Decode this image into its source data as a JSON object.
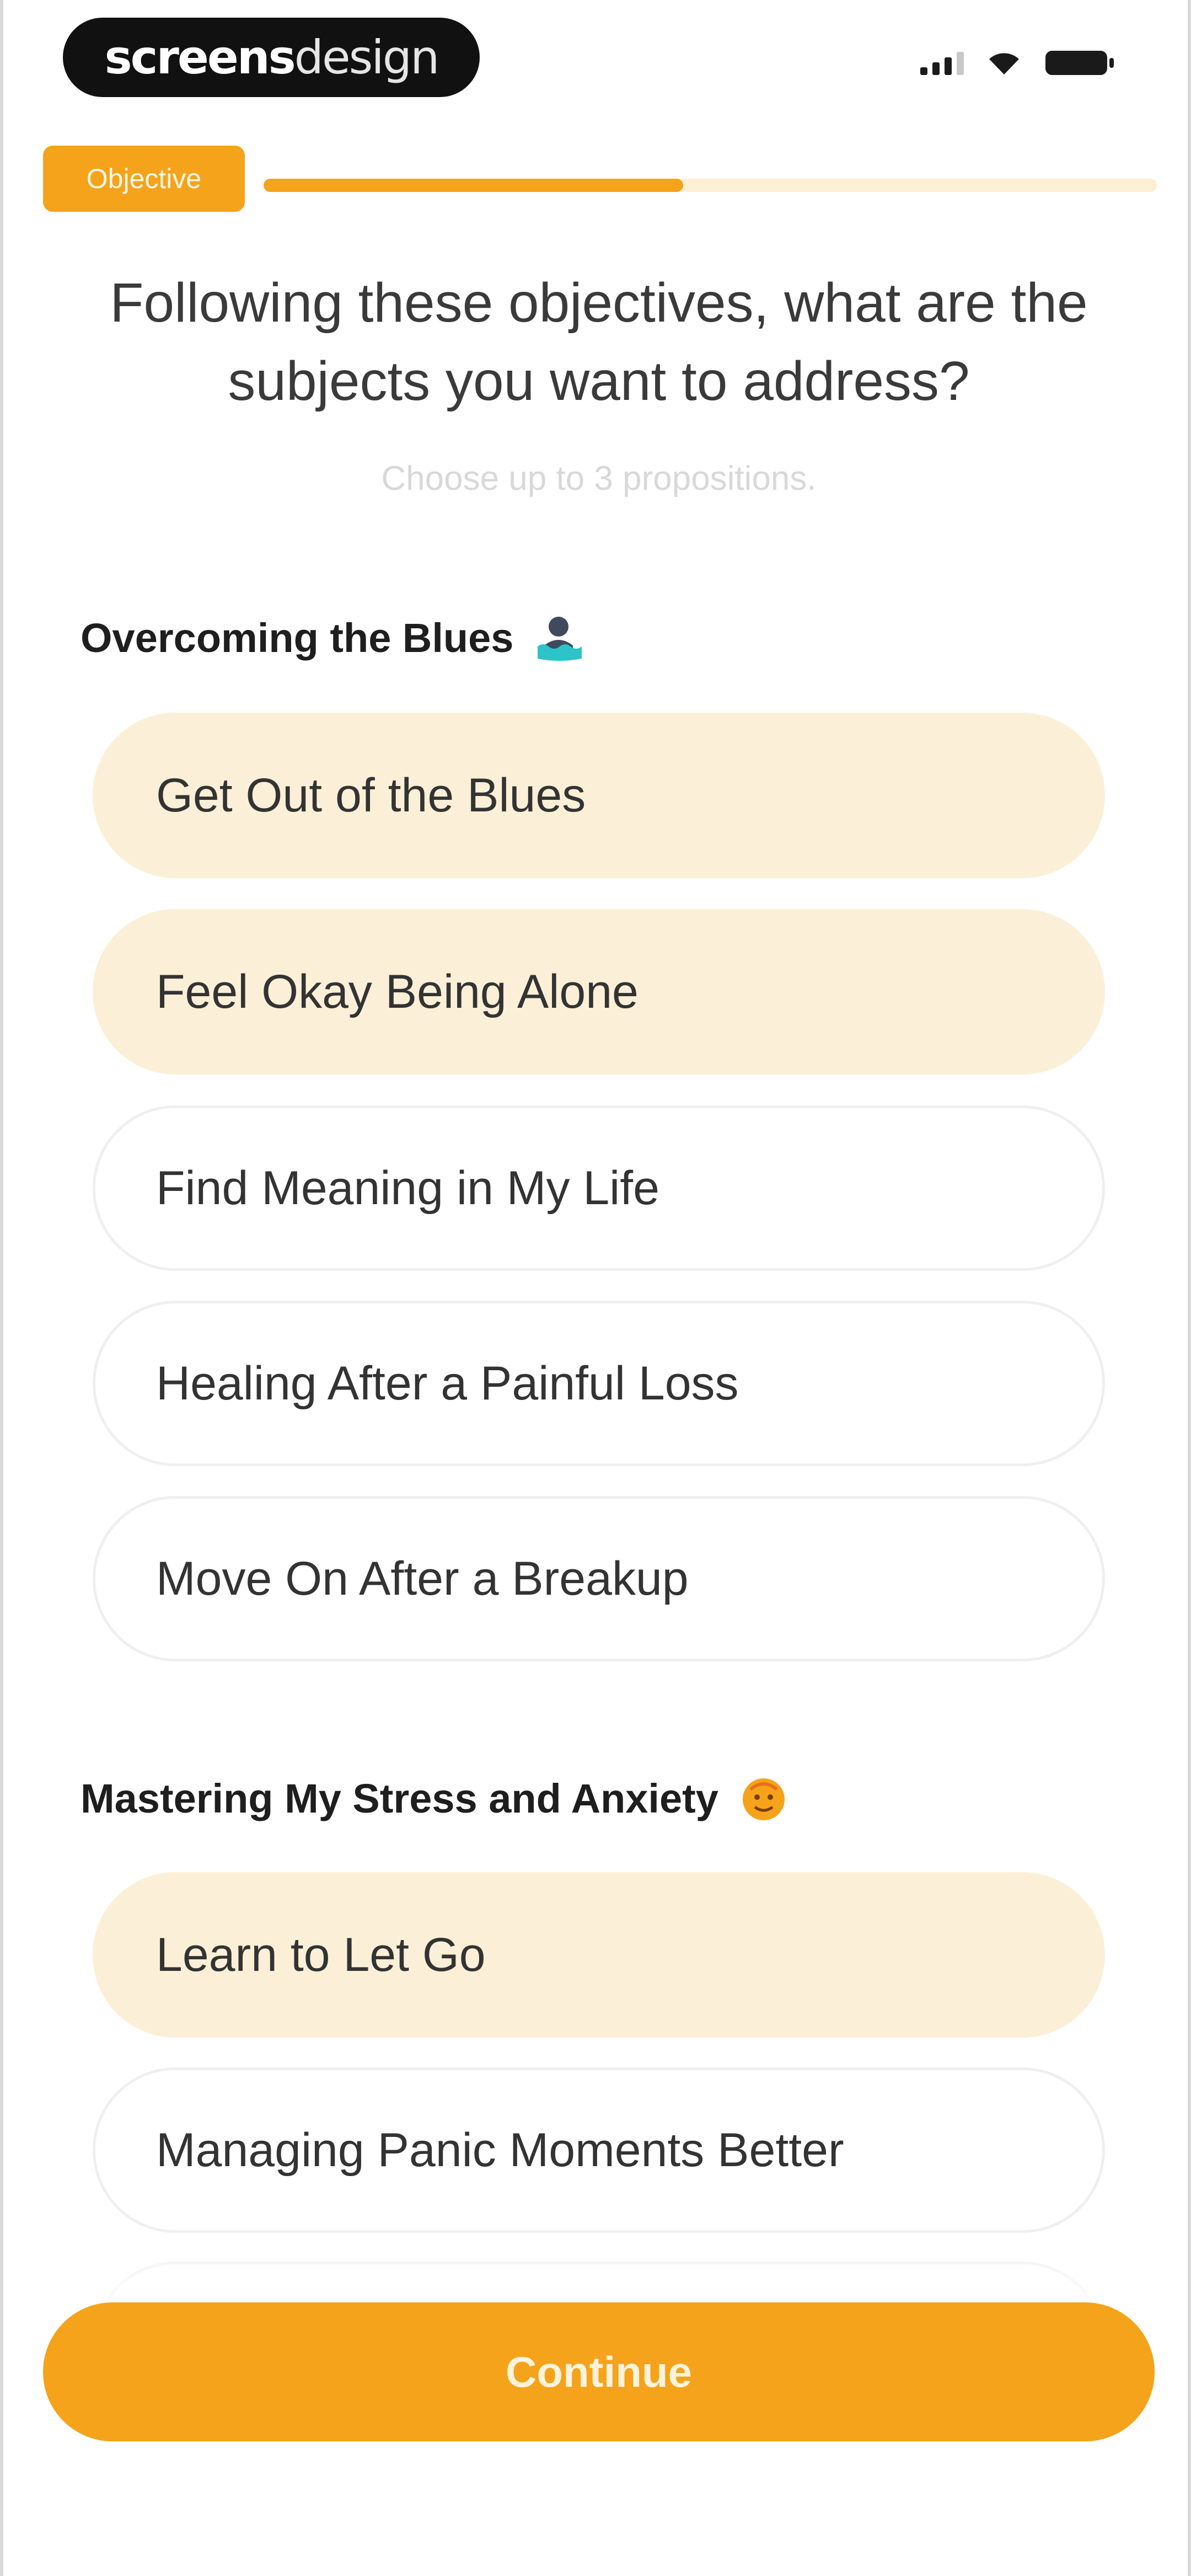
{
  "status_bar": {
    "brand_bold": "screens",
    "brand_light": "design",
    "icons": [
      "signal-icon",
      "wifi-icon",
      "battery-icon"
    ]
  },
  "progress": {
    "step_label": "Objective",
    "fraction": 0.47
  },
  "question": "Following these objectives, what are the subjects you want to address?",
  "hint": "Choose up to 3 propositions.",
  "sections": [
    {
      "title": "Overcoming the Blues",
      "icon": "person-in-water-icon",
      "options": [
        {
          "label": "Get Out of the Blues",
          "selected": true
        },
        {
          "label": "Feel Okay Being Alone",
          "selected": true
        },
        {
          "label": "Find Meaning in My Life",
          "selected": false
        },
        {
          "label": "Healing After a Painful Loss",
          "selected": false
        },
        {
          "label": "Move On After a Breakup",
          "selected": false
        }
      ]
    },
    {
      "title": "Mastering My Stress and Anxiety",
      "icon": "hot-face-icon",
      "options": [
        {
          "label": "Learn to Let Go",
          "selected": true
        },
        {
          "label": "Managing Panic Moments Better",
          "selected": false
        }
      ]
    }
  ],
  "continue_label": "Continue",
  "colors": {
    "accent": "#f5a31a",
    "selected_option_bg": "#fbf0d7",
    "track": "#fcefd3"
  }
}
